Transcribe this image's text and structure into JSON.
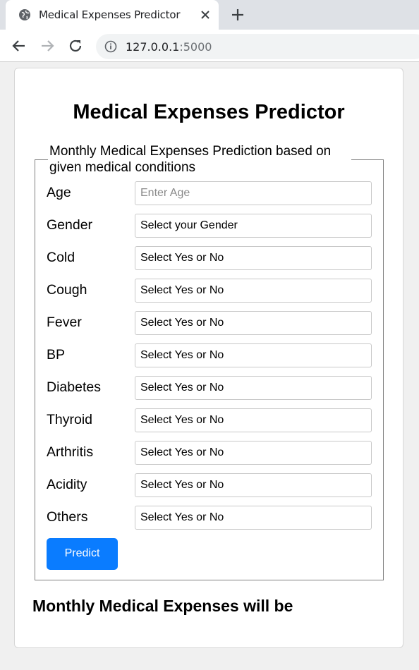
{
  "browser": {
    "tab_title": "Medical Expenses Predictor",
    "url_host": "127.0.0.1",
    "url_port": ":5000"
  },
  "page": {
    "title": "Medical Expenses Predictor",
    "legend": "Monthly Medical Expenses Prediction based on given medical conditions",
    "fields": [
      {
        "label": "Age",
        "value": "",
        "placeholder": "Enter Age"
      },
      {
        "label": "Gender",
        "value": "Select your Gender"
      },
      {
        "label": "Cold",
        "value": "Select Yes or No"
      },
      {
        "label": "Cough",
        "value": "Select Yes or No"
      },
      {
        "label": "Fever",
        "value": "Select Yes or No"
      },
      {
        "label": "BP",
        "value": "Select Yes or No"
      },
      {
        "label": "Diabetes",
        "value": "Select Yes or No"
      },
      {
        "label": "Thyroid",
        "value": "Select Yes or No"
      },
      {
        "label": "Arthritis",
        "value": "Select Yes or No"
      },
      {
        "label": "Acidity",
        "value": "Select Yes or No"
      },
      {
        "label": "Others",
        "value": "Select Yes or No"
      }
    ],
    "predict_label": "Predict",
    "result_text": "Monthly Medical Expenses will be"
  },
  "colors": {
    "accent": "#0a7cff",
    "tabstrip": "#dee1e6"
  }
}
